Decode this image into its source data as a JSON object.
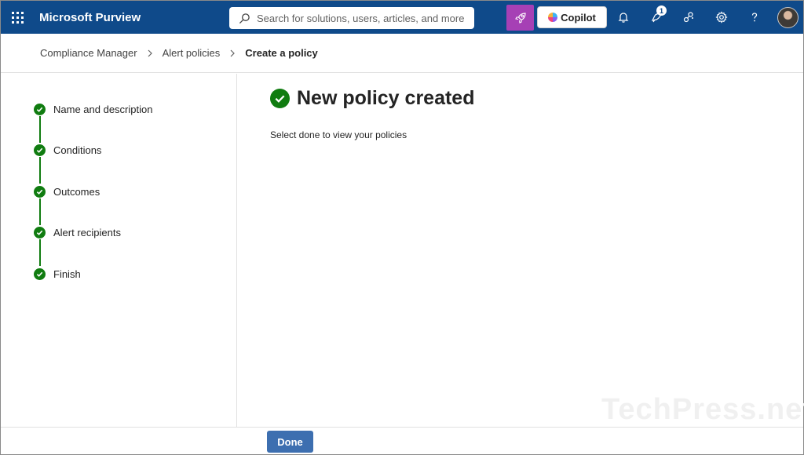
{
  "header": {
    "app_title": "Microsoft Purview",
    "search_placeholder": "Search for solutions, users, articles, and more",
    "copilot_label": "Copilot",
    "notification_count": "1",
    "colors": {
      "bar": "#0f4a8a",
      "magic_button": "#a640b5"
    },
    "icons": [
      "waffle-icon",
      "search-icon",
      "rocket-icon",
      "copilot-icon",
      "bell-icon",
      "megaphone-icon",
      "network-icon",
      "gear-icon",
      "help-icon",
      "avatar"
    ]
  },
  "breadcrumb": {
    "items": [
      "Compliance Manager",
      "Alert policies"
    ],
    "current": "Create a policy"
  },
  "wizard": {
    "steps": [
      {
        "label": "Name and description"
      },
      {
        "label": "Conditions"
      },
      {
        "label": "Outcomes"
      },
      {
        "label": "Alert recipients"
      },
      {
        "label": "Finish"
      }
    ],
    "color": "#107c10"
  },
  "main": {
    "title": "New policy created",
    "description": "Select done to view your policies"
  },
  "watermark": "TechPress.net",
  "footer": {
    "done_label": "Done",
    "button_color": "#3d6fb0"
  }
}
